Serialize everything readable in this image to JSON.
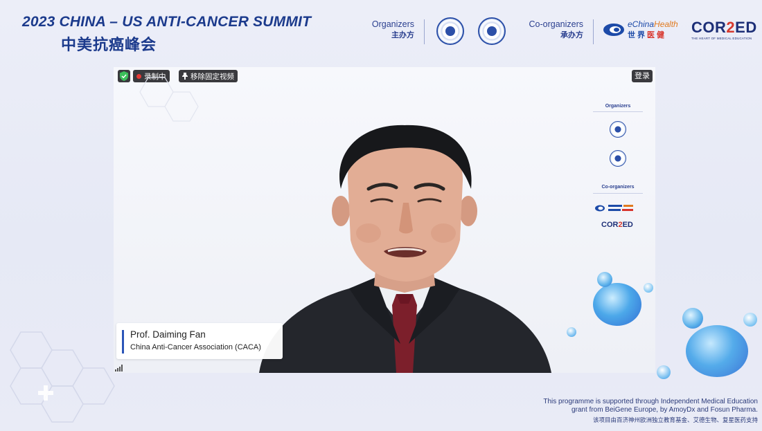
{
  "header": {
    "title_en": "2023 CHINA – US ANTI-CANCER SUMMIT",
    "title_cn": "中美抗癌峰会",
    "organizers_label": "Organizers",
    "organizers_label_cn": "主办方",
    "coorganizers_label": "Co-organizers",
    "coorganizers_label_cn": "承办方",
    "echina_logo_text": "eChina",
    "echina_logo_text_hl": "Health",
    "echina_logo_cn": "世界",
    "echina_logo_cn_r": "医健",
    "cor2ed_a": "COR",
    "cor2ed_b": "2",
    "cor2ed_c": "ED",
    "cor2ed_sub": "THE HEART OF MEDICAL EDUCATION"
  },
  "video": {
    "toolbar": {
      "recording_label": "录制中",
      "unpin_label": "移除固定视频"
    },
    "login_label": "登录",
    "speaker": {
      "name": "Prof. Daiming Fan",
      "affiliation": "China Anti-Cancer Association (CACA)"
    },
    "overlay": {
      "organizers_label": "Organizers",
      "coorganizers_label": "Co-organizers",
      "cor2ed_a": "COR",
      "cor2ed_b": "2",
      "cor2ed_c": "ED"
    }
  },
  "footer": {
    "line1": "This programme is supported through Independent Medical Education",
    "line2": "grant from BeiGene Europe, by AmoyDx and Fosun Pharma.",
    "line_cn": "该项目由百济神州欧洲独立教育基金、艾德生物、复星医药支持"
  },
  "colors": {
    "brand_blue": "#1b3a8c",
    "accent_red": "#d63a2f",
    "toolbar_bg": "#3a3a3e"
  }
}
